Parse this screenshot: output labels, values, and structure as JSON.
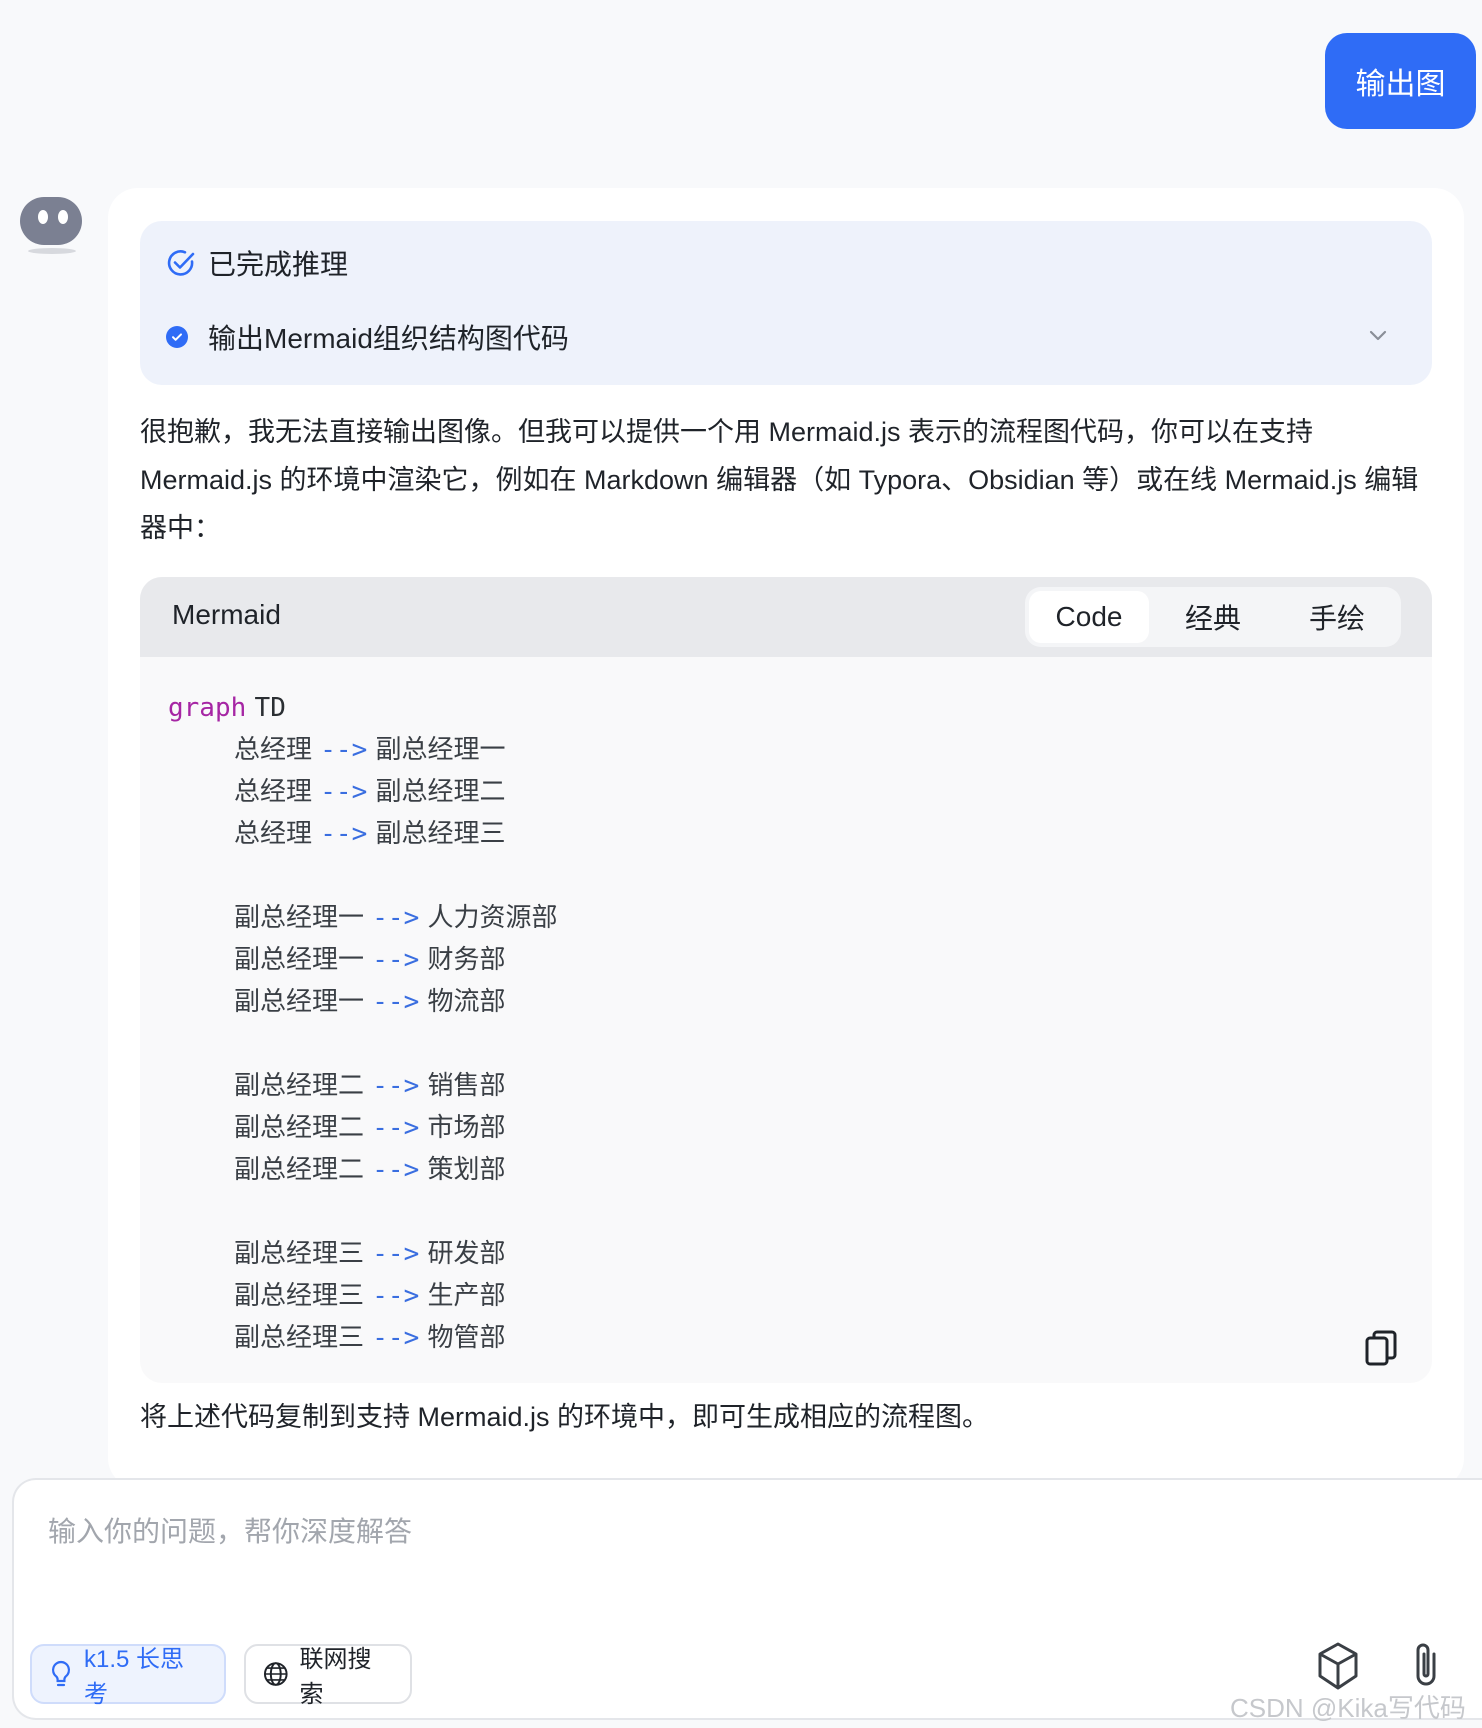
{
  "user_message": {
    "text": "输出图"
  },
  "reasoning": {
    "status": "已完成推理",
    "step": "输出Mermaid组织结构图代码"
  },
  "answer": {
    "intro": "很抱歉，我无法直接输出图像。但我可以提供一个用 Mermaid.js 表示的流程图代码，你可以在支持 Mermaid.js 的环境中渲染它，例如在 Markdown 编辑器（如 Typora、Obsidian 等）或在线 Mermaid.js 编辑器中：",
    "outro": "将上述代码复制到支持 Mermaid.js 的环境中，即可生成相应的流程图。"
  },
  "code_block": {
    "language": "Mermaid",
    "tabs": [
      "Code",
      "经典",
      "手绘"
    ],
    "active_tab": "Code",
    "header": {
      "keyword": "graph",
      "direction": "TD"
    },
    "arrow": "-->",
    "lines": [
      {
        "from": "总经理",
        "to": "副总经理一"
      },
      {
        "from": "总经理",
        "to": "副总经理二"
      },
      {
        "from": "总经理",
        "to": "副总经理三"
      },
      {
        "from": "副总经理一",
        "to": "人力资源部"
      },
      {
        "from": "副总经理一",
        "to": "财务部"
      },
      {
        "from": "副总经理一",
        "to": "物流部"
      },
      {
        "from": "副总经理二",
        "to": "销售部"
      },
      {
        "from": "副总经理二",
        "to": "市场部"
      },
      {
        "from": "副总经理二",
        "to": "策划部"
      },
      {
        "from": "副总经理三",
        "to": "研发部"
      },
      {
        "from": "副总经理三",
        "to": "生产部"
      },
      {
        "from": "副总经理三",
        "to": "物管部"
      }
    ]
  },
  "input": {
    "placeholder": "输入你的问题，帮你深度解答",
    "model_toggle": "k1.5 长思考",
    "search_toggle": "联网搜索"
  },
  "watermark": "CSDN @Kika写代码",
  "colors": {
    "accent": "#2f6cf6",
    "keyword": "#a626a4",
    "arrow": "#3a6ee0"
  }
}
